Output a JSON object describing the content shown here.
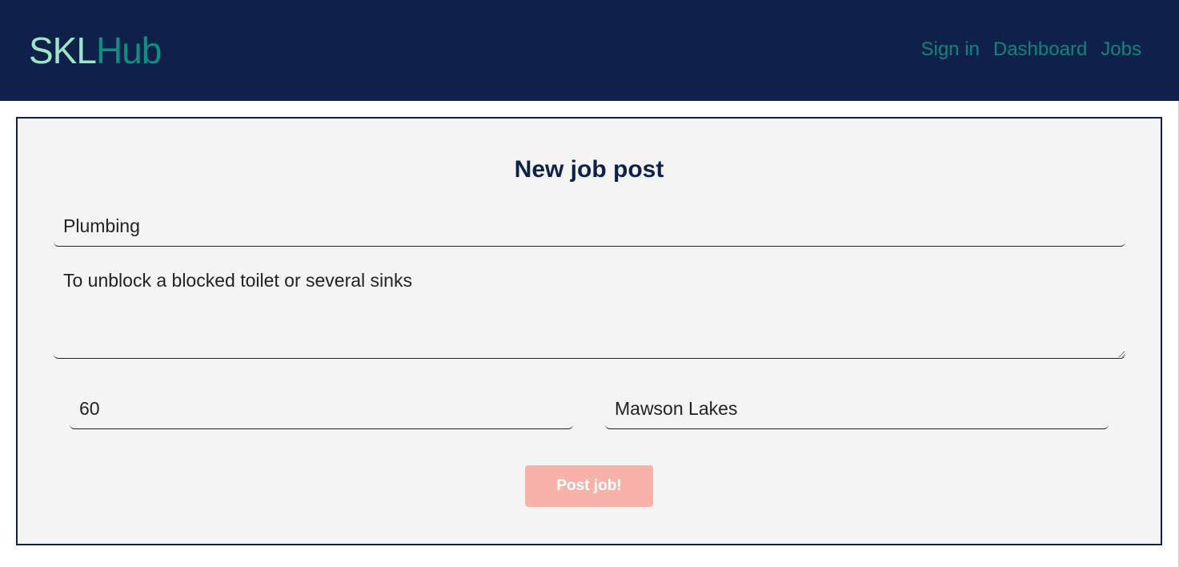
{
  "header": {
    "logo_part1": "SKL",
    "logo_part2": "Hub",
    "nav": {
      "sign_in": "Sign in",
      "dashboard": "Dashboard",
      "jobs": "Jobs"
    }
  },
  "form": {
    "title": "New job post",
    "job_title_value": "Plumbing",
    "description_value": "To unblock a blocked toilet or several sinks",
    "rate_value": "60",
    "location_value": "Mawson Lakes",
    "submit_label": "Post job!"
  },
  "colors": {
    "header_bg": "#0f214a",
    "logo_skl": "#9ee5c4",
    "logo_hub": "#0e8f84",
    "nav_link": "#11857d",
    "card_bg": "#f4f4f4",
    "button_bg": "#f7b3aa"
  }
}
